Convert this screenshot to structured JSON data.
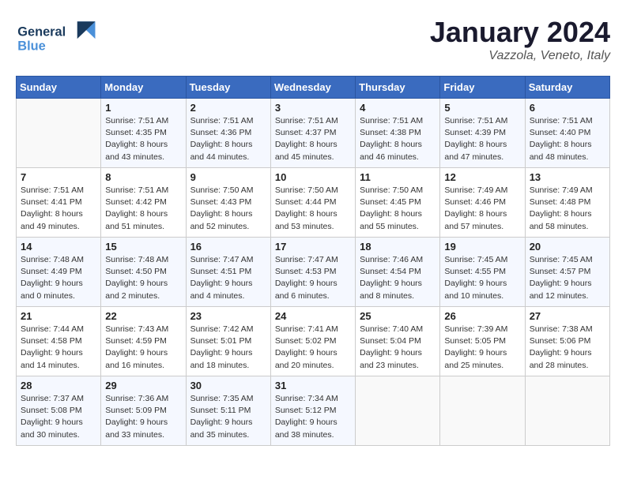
{
  "header": {
    "logo_line1": "General",
    "logo_line2": "Blue",
    "month": "January 2024",
    "location": "Vazzola, Veneto, Italy"
  },
  "days_of_week": [
    "Sunday",
    "Monday",
    "Tuesday",
    "Wednesday",
    "Thursday",
    "Friday",
    "Saturday"
  ],
  "weeks": [
    [
      {
        "day": "",
        "info": ""
      },
      {
        "day": "1",
        "info": "Sunrise: 7:51 AM\nSunset: 4:35 PM\nDaylight: 8 hours\nand 43 minutes."
      },
      {
        "day": "2",
        "info": "Sunrise: 7:51 AM\nSunset: 4:36 PM\nDaylight: 8 hours\nand 44 minutes."
      },
      {
        "day": "3",
        "info": "Sunrise: 7:51 AM\nSunset: 4:37 PM\nDaylight: 8 hours\nand 45 minutes."
      },
      {
        "day": "4",
        "info": "Sunrise: 7:51 AM\nSunset: 4:38 PM\nDaylight: 8 hours\nand 46 minutes."
      },
      {
        "day": "5",
        "info": "Sunrise: 7:51 AM\nSunset: 4:39 PM\nDaylight: 8 hours\nand 47 minutes."
      },
      {
        "day": "6",
        "info": "Sunrise: 7:51 AM\nSunset: 4:40 PM\nDaylight: 8 hours\nand 48 minutes."
      }
    ],
    [
      {
        "day": "7",
        "info": "Sunrise: 7:51 AM\nSunset: 4:41 PM\nDaylight: 8 hours\nand 49 minutes."
      },
      {
        "day": "8",
        "info": "Sunrise: 7:51 AM\nSunset: 4:42 PM\nDaylight: 8 hours\nand 51 minutes."
      },
      {
        "day": "9",
        "info": "Sunrise: 7:50 AM\nSunset: 4:43 PM\nDaylight: 8 hours\nand 52 minutes."
      },
      {
        "day": "10",
        "info": "Sunrise: 7:50 AM\nSunset: 4:44 PM\nDaylight: 8 hours\nand 53 minutes."
      },
      {
        "day": "11",
        "info": "Sunrise: 7:50 AM\nSunset: 4:45 PM\nDaylight: 8 hours\nand 55 minutes."
      },
      {
        "day": "12",
        "info": "Sunrise: 7:49 AM\nSunset: 4:46 PM\nDaylight: 8 hours\nand 57 minutes."
      },
      {
        "day": "13",
        "info": "Sunrise: 7:49 AM\nSunset: 4:48 PM\nDaylight: 8 hours\nand 58 minutes."
      }
    ],
    [
      {
        "day": "14",
        "info": "Sunrise: 7:48 AM\nSunset: 4:49 PM\nDaylight: 9 hours\nand 0 minutes."
      },
      {
        "day": "15",
        "info": "Sunrise: 7:48 AM\nSunset: 4:50 PM\nDaylight: 9 hours\nand 2 minutes."
      },
      {
        "day": "16",
        "info": "Sunrise: 7:47 AM\nSunset: 4:51 PM\nDaylight: 9 hours\nand 4 minutes."
      },
      {
        "day": "17",
        "info": "Sunrise: 7:47 AM\nSunset: 4:53 PM\nDaylight: 9 hours\nand 6 minutes."
      },
      {
        "day": "18",
        "info": "Sunrise: 7:46 AM\nSunset: 4:54 PM\nDaylight: 9 hours\nand 8 minutes."
      },
      {
        "day": "19",
        "info": "Sunrise: 7:45 AM\nSunset: 4:55 PM\nDaylight: 9 hours\nand 10 minutes."
      },
      {
        "day": "20",
        "info": "Sunrise: 7:45 AM\nSunset: 4:57 PM\nDaylight: 9 hours\nand 12 minutes."
      }
    ],
    [
      {
        "day": "21",
        "info": "Sunrise: 7:44 AM\nSunset: 4:58 PM\nDaylight: 9 hours\nand 14 minutes."
      },
      {
        "day": "22",
        "info": "Sunrise: 7:43 AM\nSunset: 4:59 PM\nDaylight: 9 hours\nand 16 minutes."
      },
      {
        "day": "23",
        "info": "Sunrise: 7:42 AM\nSunset: 5:01 PM\nDaylight: 9 hours\nand 18 minutes."
      },
      {
        "day": "24",
        "info": "Sunrise: 7:41 AM\nSunset: 5:02 PM\nDaylight: 9 hours\nand 20 minutes."
      },
      {
        "day": "25",
        "info": "Sunrise: 7:40 AM\nSunset: 5:04 PM\nDaylight: 9 hours\nand 23 minutes."
      },
      {
        "day": "26",
        "info": "Sunrise: 7:39 AM\nSunset: 5:05 PM\nDaylight: 9 hours\nand 25 minutes."
      },
      {
        "day": "27",
        "info": "Sunrise: 7:38 AM\nSunset: 5:06 PM\nDaylight: 9 hours\nand 28 minutes."
      }
    ],
    [
      {
        "day": "28",
        "info": "Sunrise: 7:37 AM\nSunset: 5:08 PM\nDaylight: 9 hours\nand 30 minutes."
      },
      {
        "day": "29",
        "info": "Sunrise: 7:36 AM\nSunset: 5:09 PM\nDaylight: 9 hours\nand 33 minutes."
      },
      {
        "day": "30",
        "info": "Sunrise: 7:35 AM\nSunset: 5:11 PM\nDaylight: 9 hours\nand 35 minutes."
      },
      {
        "day": "31",
        "info": "Sunrise: 7:34 AM\nSunset: 5:12 PM\nDaylight: 9 hours\nand 38 minutes."
      },
      {
        "day": "",
        "info": ""
      },
      {
        "day": "",
        "info": ""
      },
      {
        "day": "",
        "info": ""
      }
    ]
  ]
}
